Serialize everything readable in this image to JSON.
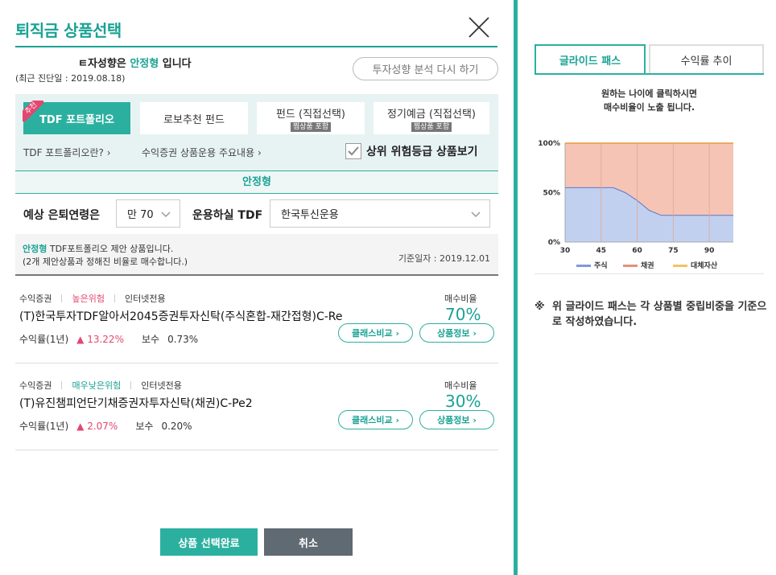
{
  "header": {
    "title": "퇴직금 상품선택"
  },
  "profile": {
    "prefix": "ㅌ자성향은 ",
    "style": "안정형",
    "suffix": " 입니다",
    "diagnosis_date": "(최근 진단일 : 2019.08.18)",
    "reanalyze_label": "투자성향 분석 다시 하기"
  },
  "product_tabs": [
    {
      "label": "TDF 포트폴리오",
      "badge": "추천"
    },
    {
      "label": "로보추천 펀드"
    },
    {
      "label": "펀드 (직접선택)",
      "sub": "찜상품 포함"
    },
    {
      "label": "정기예금 (직접선택)",
      "sub": "찜상품 포함"
    }
  ],
  "links": {
    "tdf_what": "TDF 포트폴리오란?",
    "operation": "수익증권 상품운용 주요내용"
  },
  "risk_checkbox": {
    "label": "상위 위험등급 상품보기",
    "checked": true
  },
  "style_bar": "안정형",
  "filters": {
    "retire_age_label": "예상 은퇴연령은",
    "retire_age_value": "만 70",
    "manager_label": "운용하실 TDF",
    "manager_value": "한국투신운용"
  },
  "info": {
    "style": "안정형",
    "line1_rest": " TDF포트폴리오 제안 상품입니다.",
    "line2": "(2개 제안상품과 정해진 비율로 매수합니다.)",
    "base_date": "기준일자 : 2019.12.01"
  },
  "products": [
    {
      "type": "수익증권",
      "risk": "높은위험",
      "channel": "인터넷전용",
      "name": "(T)한국투자TDF알아서2045증권투자신탁(주식혼합-재간접형)C-Re",
      "return_label": "수익률(1년)",
      "return_value": "▲ 13.22%",
      "fee_label": "보수",
      "fee_value": "0.73%",
      "ratio_label": "매수비율",
      "ratio_value": "70%",
      "compare_label": "클래스비교",
      "info_label": "상품정보"
    },
    {
      "type": "수익증권",
      "risk": "매우낮은위험",
      "channel": "인터넷전용",
      "name": "(T)유진챔피언단기채증권자투자신탁(채권)C-Pe2",
      "return_label": "수익률(1년)",
      "return_value": "▲ 2.07%",
      "fee_label": "보수",
      "fee_value": "0.20%",
      "ratio_label": "매수비율",
      "ratio_value": "30%",
      "compare_label": "클래스비교",
      "info_label": "상품정보"
    }
  ],
  "actions": {
    "confirm": "상품 선택완료",
    "cancel": "취소"
  },
  "right_tabs": [
    {
      "label": "글라이드 패스"
    },
    {
      "label": "수익률 추이"
    }
  ],
  "chart_hint": {
    "line1": "원하는 나이에 클릭하시면",
    "line2": "매수비율이 노출 됩니다."
  },
  "chart_data": {
    "type": "area",
    "x": [
      30,
      50,
      55,
      60,
      65,
      70,
      100
    ],
    "series": [
      {
        "name": "주식",
        "color": "#c2d0f0",
        "values": [
          55,
          55,
          50,
          42,
          32,
          27,
          27
        ]
      },
      {
        "name": "채권",
        "color": "#f5c4b5",
        "values": [
          45,
          45,
          50,
          58,
          68,
          73,
          73
        ]
      },
      {
        "name": "대체자산",
        "color": "#f2c267",
        "values": [
          0,
          0,
          0,
          0,
          0,
          0,
          0
        ]
      }
    ],
    "x_ticks": [
      "30",
      "45",
      "60",
      "75",
      "90"
    ],
    "y_ticks": [
      "0%",
      "50%",
      "100%"
    ],
    "xlim": [
      30,
      100
    ],
    "ylim": [
      0,
      100
    ],
    "stacked": true,
    "legend_position": "bottom",
    "grid": true
  },
  "note": {
    "mark": "※",
    "text": "위 글라이드 패스는 각 상품별 중립비중을 기준으로 작성하였습니다."
  },
  "colors": {
    "accent": "#2bb0a0",
    "accent_text": "#1aa294",
    "risk_high": "#e34770",
    "cancel": "#5f6a73"
  }
}
